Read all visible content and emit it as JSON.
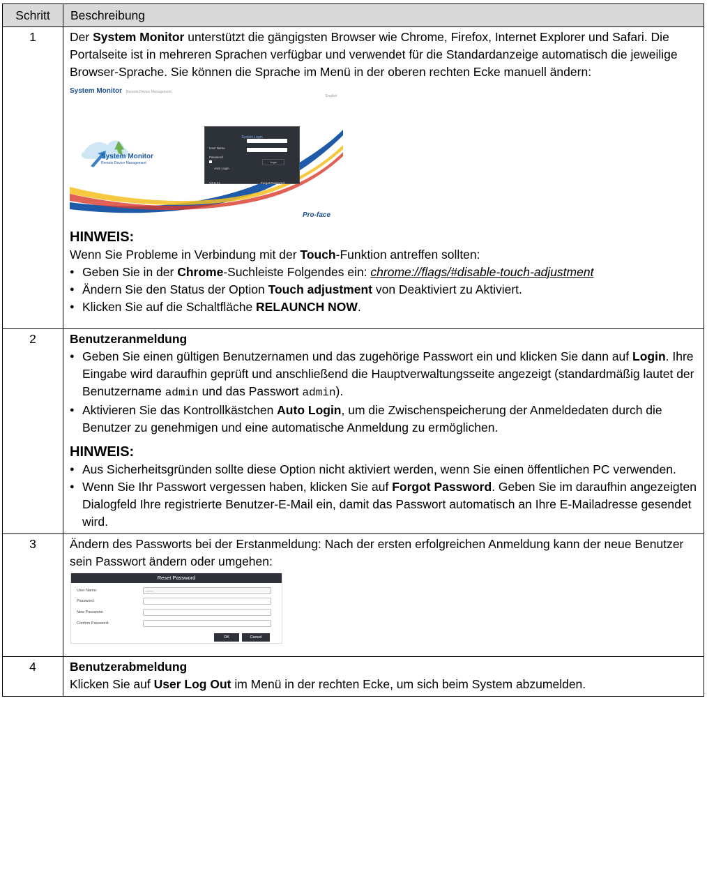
{
  "header": {
    "col_step": "Schritt",
    "col_desc": "Beschreibung"
  },
  "row1": {
    "num": "1",
    "t1": "Der ",
    "b1": "System Monitor",
    "t2": " unterstützt die gängigsten Browser wie Chrome, Firefox, Internet Explorer und Safari. Die Portalseite ist in mehreren Sprachen verfügbar und verwendet für die Standardanzeige automatisch die jeweilige Browser-Sprache. Sie können die Sprache im Menü in der oberen rechten Ecke manuell ändern:",
    "screenshot": {
      "header_title": "System Monitor",
      "header_subtitle": "Remote Device Management",
      "language": "English",
      "login_title": "System Login",
      "user_name_label": "User Name",
      "password_label": "Password",
      "auto_login_label": "Auto Login",
      "login_button": "Login",
      "version": "V3.6.31",
      "forgot_password": "Forgot Password",
      "brand_title": "System Monitor",
      "brand_subtitle": "Remote Device Management",
      "proface_logo": "Pro-face"
    },
    "note_title": "HINWEIS:",
    "note_t1": "Wenn Sie Probleme in Verbindung mit der ",
    "note_b1": "Touch",
    "note_t2": "-Funktion antreffen sollten:",
    "bullet1_t1": "Geben Sie in der ",
    "bullet1_b1": "Chrome",
    "bullet1_t2": "-Suchleiste Folgendes ein: ",
    "bullet1_link": "chrome://flags/#disable-touch-adjustment",
    "bullet2_t1": "Ändern Sie den Status der Option ",
    "bullet2_b1": "Touch adjustment",
    "bullet2_t2": " von Deaktiviert zu Aktiviert.",
    "bullet3_t1": "Klicken Sie auf die Schaltfläche ",
    "bullet3_b1": "RELAUNCH NOW",
    "bullet3_t2": "."
  },
  "row2": {
    "num": "2",
    "heading": "Benutzeranmeldung",
    "bullet1_t1": "Geben Sie einen gültigen Benutzernamen und das zugehörige Passwort ein und klicken Sie dann auf ",
    "bullet1_b1": "Login",
    "bullet1_t2": ". Ihre Eingabe wird daraufhin geprüft und anschließend die Hauptverwaltungsseite angezeigt (standardmäßig lautet der Benutzername ",
    "bullet1_code1": "admin",
    "bullet1_t3": " und das Passwort ",
    "bullet1_code2": "admin",
    "bullet1_t4": ").",
    "bullet2_t1": "Aktivieren Sie das Kontrollkästchen ",
    "bullet2_b1": "Auto Login",
    "bullet2_t2": ", um die Zwischenspeicherung der Anmeldedaten durch die Benutzer zu genehmigen und eine automatische Anmeldung zu ermöglichen.",
    "note_title": "HINWEIS:",
    "note_bullet1": "Aus Sicherheitsgründen sollte diese Option nicht aktiviert werden, wenn Sie einen öffentlichen PC verwenden.",
    "note_bullet2_t1": "Wenn Sie Ihr Passwort vergessen haben, klicken Sie auf ",
    "note_bullet2_b1": "Forgot Password",
    "note_bullet2_t2": ". Geben Sie im daraufhin angezeigten Dialogfeld Ihre registrierte Benutzer-E-Mail ein, damit das Passwort automatisch an Ihre E-Mailadresse gesendet wird."
  },
  "row3": {
    "num": "3",
    "text": "Ändern des Passworts bei der Erstanmeldung: Nach der ersten erfolgreichen Anmeldung kann der neue Benutzer sein Passwort ändern oder umgehen:",
    "screenshot": {
      "title": "Reset Password",
      "user_name_label": "User Name:",
      "user_name_value": "admin",
      "password_label": "Password:",
      "new_password_label": "New Password:",
      "confirm_password_label": "Confirm Password:",
      "ok_button": "OK",
      "cancel_button": "Cancel"
    }
  },
  "row4": {
    "num": "4",
    "heading": "Benutzerabmeldung",
    "t1": "Klicken Sie auf ",
    "b1": "User Log Out",
    "t2": " im Menü in der rechten Ecke, um sich beim System abzumelden."
  }
}
